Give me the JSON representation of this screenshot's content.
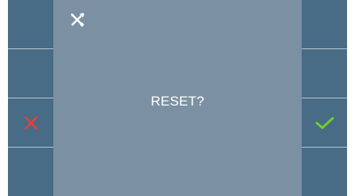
{
  "screen": {
    "message": "RESET?"
  },
  "icons": {
    "header": "tools-icon",
    "cancel": "close-icon",
    "confirm": "check-icon"
  },
  "colors": {
    "panel": "#7b91a3",
    "side_buttons": "#486b86",
    "dividers": "#b7c7d3",
    "cancel": "#e0443a",
    "confirm": "#6fcf2f",
    "text": "#ffffff"
  }
}
